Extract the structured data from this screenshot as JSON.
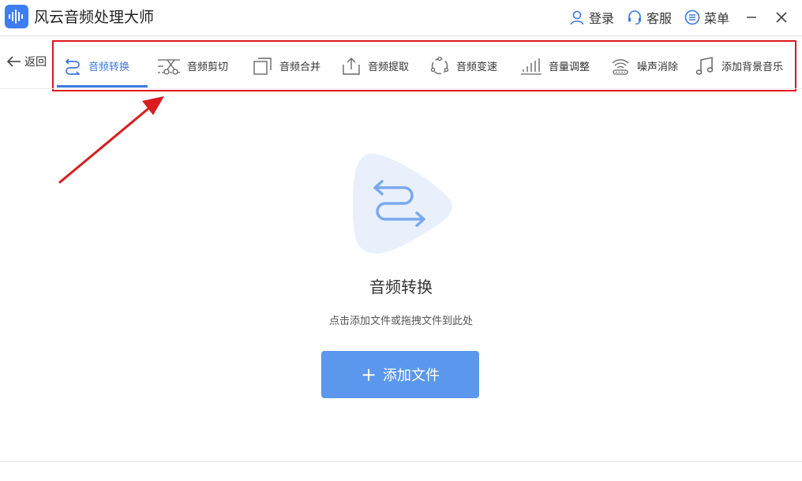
{
  "app": {
    "title": "风云音频处理大师",
    "accent_color": "#3a78e0",
    "logo_icon": "sound-wave-icon"
  },
  "top_actions": [
    {
      "label": "登录",
      "icon": "user-icon"
    },
    {
      "label": "客服",
      "icon": "headset-icon"
    },
    {
      "label": "菜单",
      "icon": "menu-list-icon"
    }
  ],
  "window_controls": [
    "minimize-icon",
    "close-icon"
  ],
  "toolbar": {
    "back_label": "返回",
    "tabs": [
      {
        "label": "音频转换",
        "icon": "convert-arrows-icon",
        "active": true
      },
      {
        "label": "音频剪切",
        "icon": "scissors-icon",
        "active": false
      },
      {
        "label": "音频合并",
        "icon": "merge-squares-icon",
        "active": false
      },
      {
        "label": "音频提取",
        "icon": "upload-tray-icon",
        "active": false
      },
      {
        "label": "音频变速",
        "icon": "speed-circle-icon",
        "active": false
      },
      {
        "label": "音量调整",
        "icon": "volume-bars-icon",
        "active": false
      },
      {
        "label": "噪声消除",
        "icon": "noise-wave-icon",
        "active": false
      },
      {
        "label": "添加背景音乐",
        "icon": "music-note-icon",
        "active": false
      }
    ],
    "highlight_color": "#e0141c"
  },
  "main": {
    "hero_icon": "convert-arrows-icon",
    "title": "音频转换",
    "hint": "点击添加文件或拖拽文件到此处",
    "add_button_label": "添加文件",
    "add_button_color": "#5b97ec"
  }
}
